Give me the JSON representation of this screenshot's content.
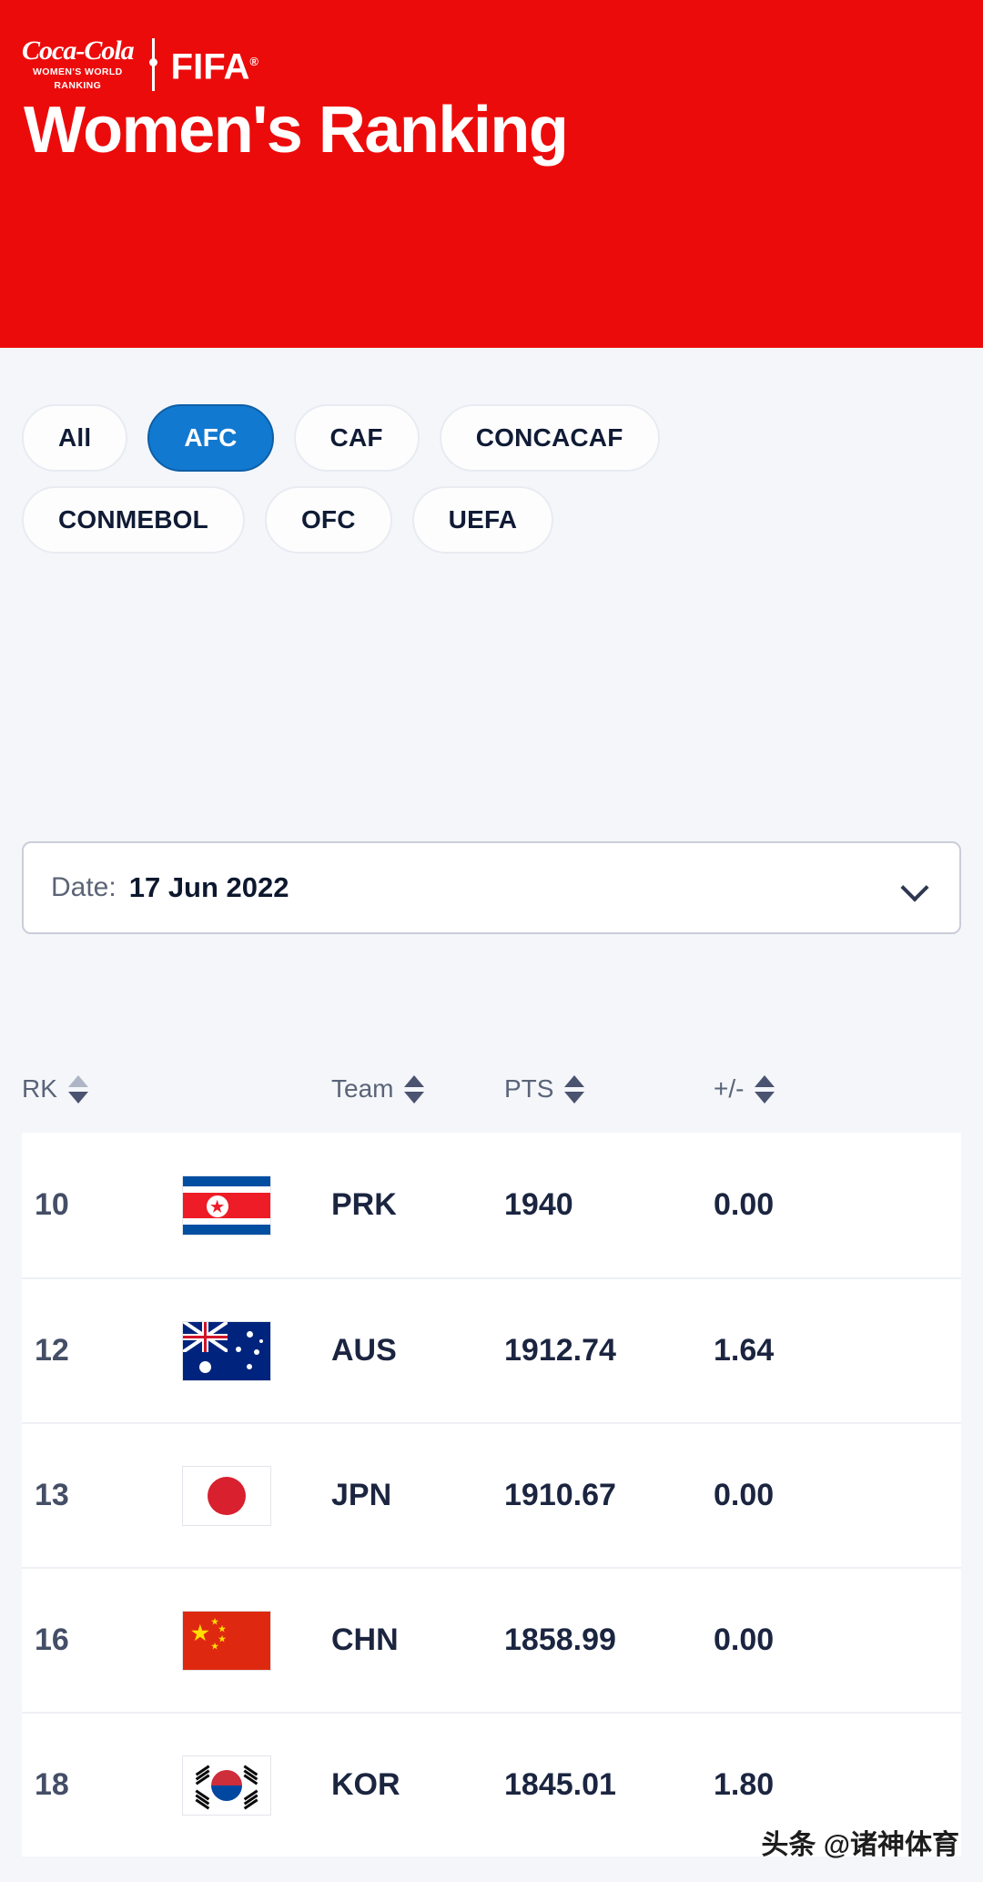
{
  "header": {
    "background_color": "#ec0b0b",
    "brand": {
      "coca_cola_script": "Coca-Cola",
      "coca_cola_sub_line1": "WOMEN'S WORLD",
      "coca_cola_sub_line2": "RANKING",
      "fifa": "FIFA",
      "fifa_trademark": "®"
    },
    "title": "Women's Ranking"
  },
  "filters": {
    "active_color": "#1279d1",
    "row1": [
      {
        "label": "All",
        "active": false
      },
      {
        "label": "AFC",
        "active": true
      },
      {
        "label": "CAF",
        "active": false
      },
      {
        "label": "CONCACAF",
        "active": false
      }
    ],
    "row2": [
      {
        "label": "CONMEBOL",
        "active": false
      },
      {
        "label": "OFC",
        "active": false
      },
      {
        "label": "UEFA",
        "active": false
      }
    ]
  },
  "date_select": {
    "label": "Date:",
    "value": "17 Jun 2022",
    "chevron_icon": "chevron-down-icon"
  },
  "table": {
    "columns": [
      {
        "key": "rk",
        "label": "RK",
        "sort": "asc"
      },
      {
        "key": "flag",
        "label": "",
        "sort": "none"
      },
      {
        "key": "team",
        "label": "Team",
        "sort": "none"
      },
      {
        "key": "pts",
        "label": "PTS",
        "sort": "none"
      },
      {
        "key": "pm",
        "label": "+/-",
        "sort": "none"
      }
    ],
    "rows": [
      {
        "rk": "10",
        "flag": "flag-prk",
        "flag_name": "north-korea-flag",
        "team": "PRK",
        "pts": "1940",
        "pm": "0.00"
      },
      {
        "rk": "12",
        "flag": "flag-aus",
        "flag_name": "australia-flag",
        "team": "AUS",
        "pts": "1912.74",
        "pm": "1.64"
      },
      {
        "rk": "13",
        "flag": "flag-jpn",
        "flag_name": "japan-flag",
        "team": "JPN",
        "pts": "1910.67",
        "pm": "0.00"
      },
      {
        "rk": "16",
        "flag": "flag-chn",
        "flag_name": "china-flag",
        "team": "CHN",
        "pts": "1858.99",
        "pm": "0.00"
      },
      {
        "rk": "18",
        "flag": "flag-kor",
        "flag_name": "south-korea-flag",
        "team": "KOR",
        "pts": "1845.01",
        "pm": "1.80"
      }
    ]
  },
  "watermark": {
    "text": "头条 @诸神体育"
  }
}
